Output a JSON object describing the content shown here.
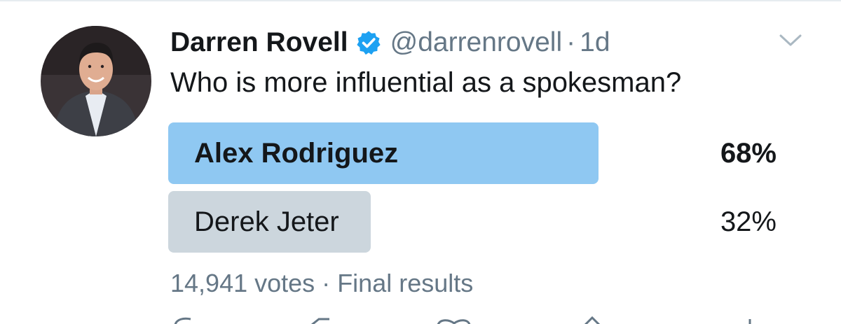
{
  "tweet": {
    "display_name": "Darren Rovell",
    "handle": "@darrenrovell",
    "separator": "·",
    "time": "1d",
    "text": "Who is more influential as a spokesman?"
  },
  "poll": {
    "options": [
      {
        "label": "Alex Rodriguez",
        "percent": "68%",
        "share": 0.68,
        "winner": true
      },
      {
        "label": "Derek Jeter",
        "percent": "32%",
        "share": 0.32,
        "winner": false
      }
    ],
    "votes": "14,941 votes",
    "footer_separator": "·",
    "status": "Final results"
  },
  "icons": {
    "verified": "verified-badge-icon",
    "menu": "chevron-down-icon"
  },
  "colors": {
    "winner_bar": "#8fc8f2",
    "other_bar": "#ccd6dd",
    "verified": "#1da1f2",
    "secondary_text": "#657786",
    "primary_text": "#14171a"
  }
}
